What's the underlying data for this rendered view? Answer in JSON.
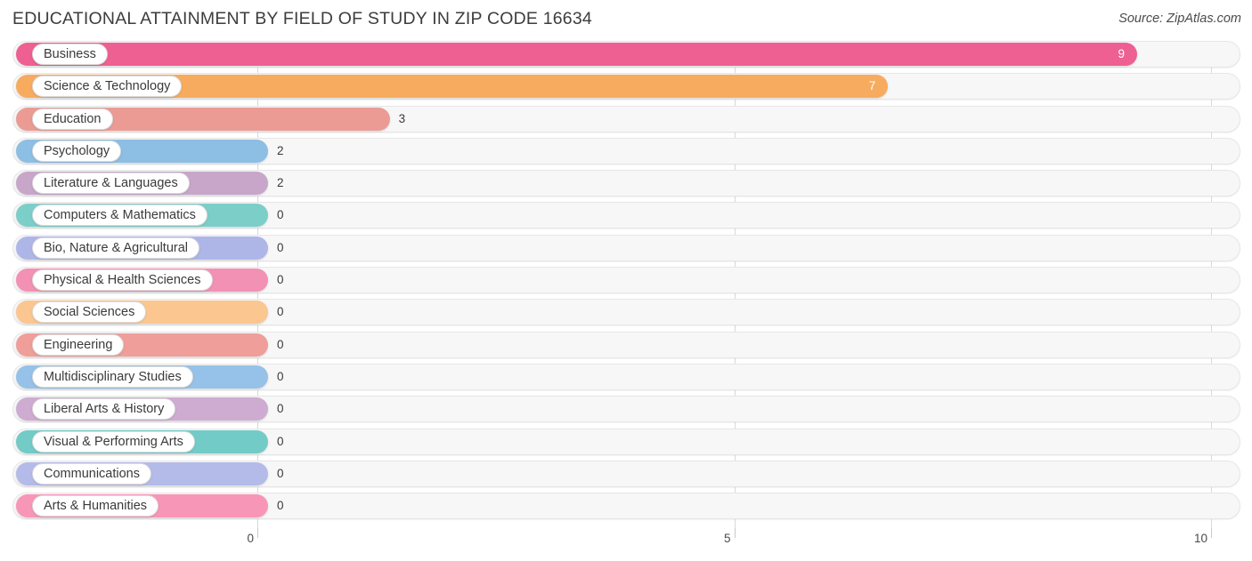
{
  "header": {
    "title": "EDUCATIONAL ATTAINMENT BY FIELD OF STUDY IN ZIP CODE 16634",
    "source": "Source: ZipAtlas.com"
  },
  "chart_data": {
    "type": "bar",
    "orientation": "horizontal",
    "title": "EDUCATIONAL ATTAINMENT BY FIELD OF STUDY IN ZIP CODE 16634",
    "xlabel": "",
    "ylabel": "",
    "xlim": [
      0,
      10
    ],
    "grid": true,
    "legend": "none",
    "xticks": [
      "0",
      "5",
      "10"
    ],
    "categories": [
      "Business",
      "Science & Technology",
      "Education",
      "Psychology",
      "Literature & Languages",
      "Computers & Mathematics",
      "Bio, Nature & Agricultural",
      "Physical & Health Sciences",
      "Social Sciences",
      "Engineering",
      "Multidisciplinary Studies",
      "Liberal Arts & History",
      "Visual & Performing Arts",
      "Communications",
      "Arts & Humanities"
    ],
    "values": [
      9,
      7,
      3,
      2,
      2,
      0,
      0,
      0,
      0,
      0,
      0,
      0,
      0,
      0,
      0
    ],
    "value_labels": [
      "9",
      "7",
      "3",
      "2",
      "2",
      "0",
      "0",
      "0",
      "0",
      "0",
      "0",
      "0",
      "0",
      "0",
      "0"
    ],
    "colors": [
      "#ee5f92",
      "#f7ab5e",
      "#eb9b94",
      "#8dbee4",
      "#c7a6ca",
      "#7ccec9",
      "#aeb6e8",
      "#f291b4",
      "#fbc68f",
      "#ef9e99",
      "#96c1e8",
      "#ceabd1",
      "#72cbc7",
      "#b4bbe9",
      "#f896b8"
    ]
  }
}
